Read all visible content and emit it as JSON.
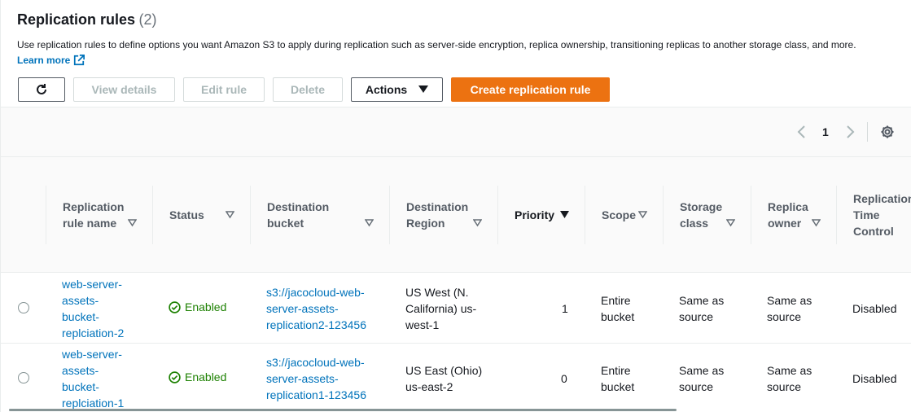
{
  "header": {
    "title": "Replication rules",
    "count": "(2)"
  },
  "description": "Use replication rules to define options you want Amazon S3 to apply during replication such as server-side encryption, replica ownership, transitioning replicas to another storage class, and more.",
  "learn_more": "Learn more",
  "toolbar": {
    "view_details": "View details",
    "edit_rule": "Edit rule",
    "delete": "Delete",
    "actions": "Actions",
    "create": "Create replication rule"
  },
  "pagination": {
    "page": "1"
  },
  "columns": {
    "name": [
      "Replication",
      "rule name"
    ],
    "status": "Status",
    "dest_bucket": [
      "Destination",
      "bucket"
    ],
    "dest_region": [
      "Destination",
      "Region"
    ],
    "priority": "Priority",
    "scope": "Scope",
    "storage": [
      "Storage",
      "class"
    ],
    "replica": [
      "Replica",
      "owner"
    ],
    "rtc": [
      "Replication",
      "Time",
      "Control"
    ]
  },
  "rows": [
    {
      "name": [
        "web-server-",
        "assets-",
        "bucket-",
        "replciation-2"
      ],
      "status": "Enabled",
      "bucket": [
        "s3://jacocloud-web-",
        "server-assets-",
        "replication2-123456"
      ],
      "region": [
        "US West (N.",
        "California) us-",
        "west-1"
      ],
      "priority": "1",
      "scope": [
        "Entire",
        "bucket"
      ],
      "storage": [
        "Same as",
        "source"
      ],
      "replica": [
        "Same as",
        "source"
      ],
      "rtc": "Disabled"
    },
    {
      "name": [
        "web-server-",
        "assets-",
        "bucket-",
        "replciation-1"
      ],
      "status": "Enabled",
      "bucket": [
        "s3://jacocloud-web-",
        "server-assets-",
        "replication1-123456"
      ],
      "region": [
        "US East (Ohio)",
        "us-east-2"
      ],
      "priority": "0",
      "scope": [
        "Entire",
        "bucket"
      ],
      "storage": [
        "Same as",
        "source"
      ],
      "replica": [
        "Same as",
        "source"
      ],
      "rtc": "Disabled"
    }
  ],
  "colors": {
    "link": "#0073bb",
    "primary": "#ec7211",
    "success": "#1d8102"
  },
  "icons": [
    "refresh-icon",
    "external-link-icon",
    "caret-down-icon",
    "chevron-left-icon",
    "chevron-right-icon",
    "gear-icon",
    "sort-icon",
    "check-circle-icon"
  ]
}
